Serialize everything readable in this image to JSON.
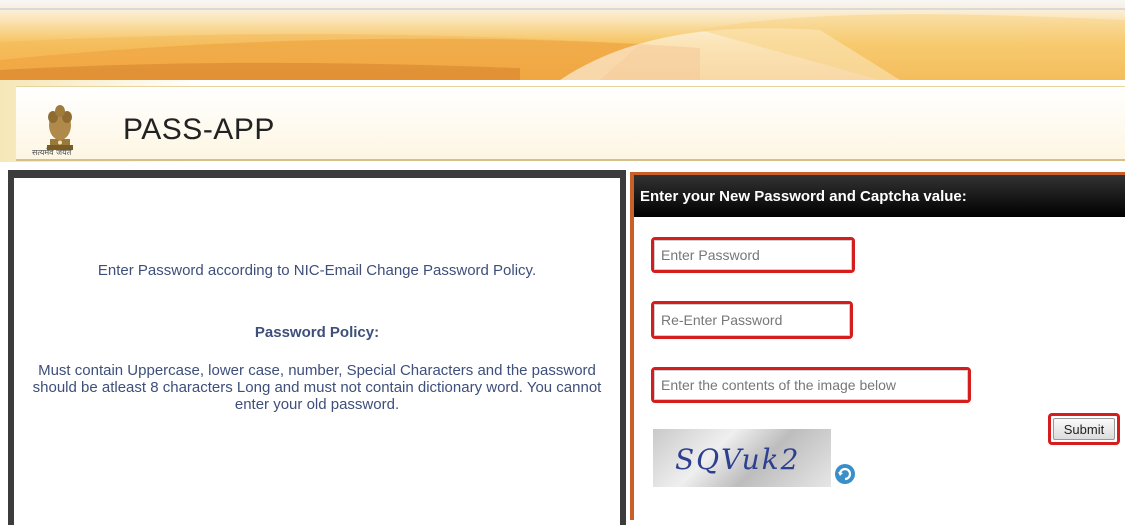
{
  "app": {
    "title": "PASS-APP",
    "emblem_caption": "सत्यमेव जयते"
  },
  "left_panel": {
    "intro": "Enter Password according to NIC-Email Change Password Policy.",
    "policy_heading": "Password Policy:",
    "policy_text": "Must contain Uppercase, lower case, number, Special Characters and the password should be atleast 8 characters Long and must not contain dictionary word. You cannot enter your old password."
  },
  "form": {
    "heading": "Enter your New Password and Captcha value:",
    "password_placeholder": "Enter Password",
    "reenter_placeholder": "Re-Enter Password",
    "captcha_placeholder": "Enter the contents of the image below",
    "captcha_text": "SQVuk2",
    "submit_label": "Submit"
  },
  "icons": {
    "emblem": "national-emblem-icon",
    "refresh": "refresh-icon"
  },
  "colors": {
    "highlight_red": "#d51d1d",
    "accent_orange": "#c9602a",
    "text_blue": "#3d4f7a"
  }
}
